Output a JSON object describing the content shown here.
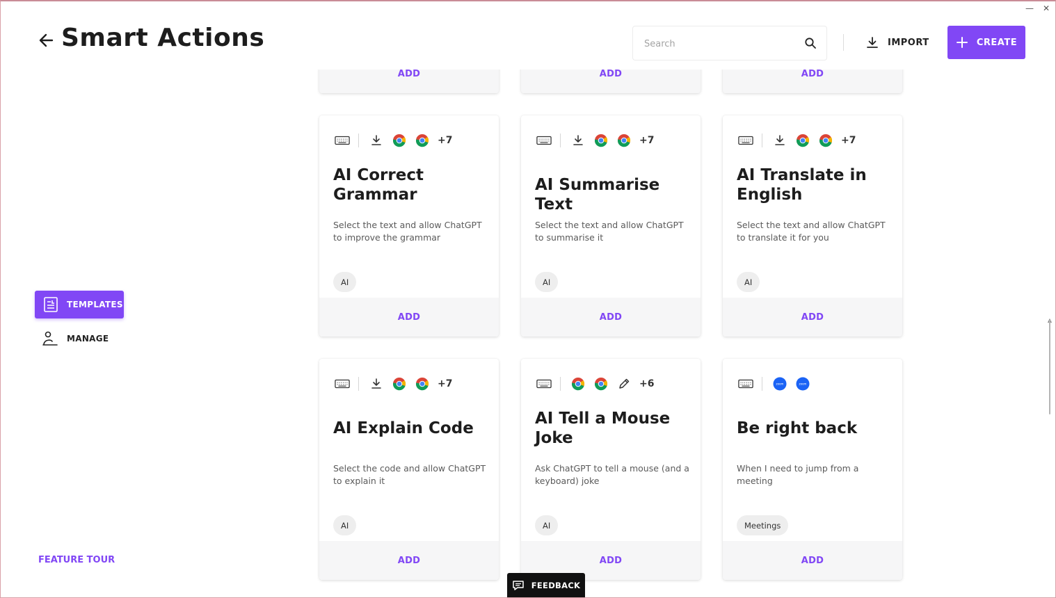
{
  "header": {
    "title": "Smart Actions",
    "search_placeholder": "Search",
    "import_label": "IMPORT",
    "create_label": "CREATE"
  },
  "nav": {
    "templates_label": "TEMPLATES",
    "manage_label": "MANAGE",
    "feature_tour_label": "FEATURE TOUR"
  },
  "add_label": "ADD",
  "feedback_label": "FEEDBACK",
  "colors": {
    "accent": "#8147f5",
    "card_footer_bg": "#f6f6f7",
    "zoom_blue": "#1b63f5"
  },
  "cards_row1": [
    {
      "add": "ADD"
    },
    {
      "add": "ADD"
    },
    {
      "add": "ADD"
    }
  ],
  "cards": [
    {
      "icons": [
        "keyboard-icon",
        "download-icon",
        "chrome-icon",
        "chrome-icon"
      ],
      "more": "+7",
      "title": "AI Correct Grammar",
      "description": "Select the text and allow ChatGPT to improve the grammar",
      "tag": "AI",
      "add": "ADD"
    },
    {
      "icons": [
        "keyboard-icon",
        "download-icon",
        "chrome-icon",
        "chrome-icon"
      ],
      "more": "+7",
      "title": "AI Summarise Text",
      "description": "Select the text and allow ChatGPT to summarise it",
      "tag": "AI",
      "add": "ADD"
    },
    {
      "icons": [
        "keyboard-icon",
        "download-icon",
        "chrome-icon",
        "chrome-icon"
      ],
      "more": "+7",
      "title": "AI Translate in English",
      "description": "Select the text and allow ChatGPT to translate it for you",
      "tag": "AI",
      "add": "ADD"
    },
    {
      "icons": [
        "keyboard-icon",
        "download-icon",
        "chrome-icon",
        "chrome-icon"
      ],
      "more": "+7",
      "title": "AI Explain Code",
      "description": "Select the code and allow ChatGPT to explain it",
      "tag": "AI",
      "add": "ADD"
    },
    {
      "icons": [
        "keyboard-icon",
        "chrome-icon",
        "chrome-icon",
        "pencil-icon"
      ],
      "more": "+6",
      "title": "AI Tell a Mouse Joke",
      "description": "Ask ChatGPT to tell a mouse (and a keyboard) joke",
      "tag": "AI",
      "add": "ADD"
    },
    {
      "icons": [
        "keyboard-icon",
        "zoom-icon",
        "zoom-icon"
      ],
      "zoom_text": "zoom",
      "more": "",
      "title": "Be right back",
      "description": "When I need to jump from a meeting",
      "tag": "Meetings",
      "add": "ADD"
    }
  ]
}
